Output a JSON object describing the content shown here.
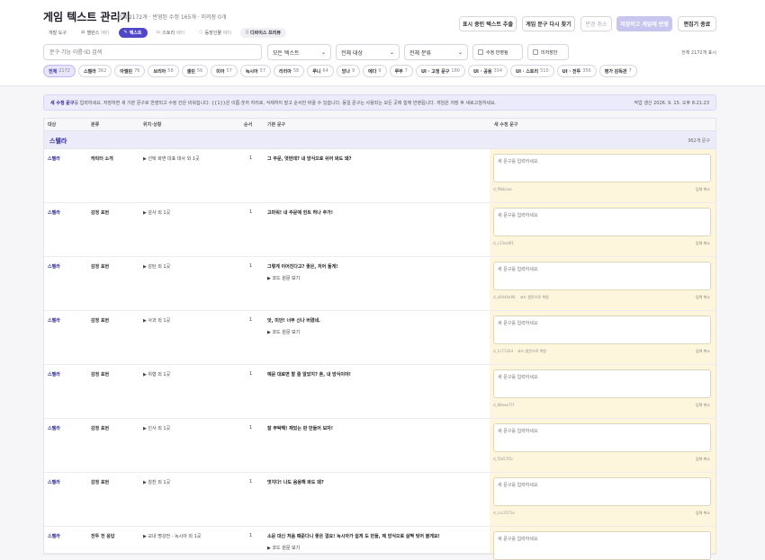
{
  "header": {
    "title": "게임 텍스트 관리기",
    "subtitle": "전체 2172개 · 반영된 수정 165개 · 미저장 0개",
    "buttons": {
      "extract": "표시 중인 텍스트 추출",
      "reload": "게임 문구 다시 찾기",
      "revert": "변경 취소",
      "save": "저장하고 게임에 반영",
      "exit": "편집기 종료"
    },
    "nav": [
      {
        "label": "개발 도구",
        "icon": "",
        "tag": ""
      },
      {
        "label": "밸런스",
        "icon": "⚖",
        "tag": "베타"
      },
      {
        "label": "텍스트",
        "icon": "✎",
        "tag": ""
      },
      {
        "label": "스토리",
        "icon": "▭",
        "tag": "베타"
      },
      {
        "label": "등장인물",
        "icon": "◌",
        "tag": "베타"
      },
      {
        "label": "디바이스 프리뷰",
        "icon": "▯",
        "tag": ""
      }
    ]
  },
  "filters": {
    "search_placeholder": "문구·기능 이름·ID 검색",
    "select1": "모든 텍스트",
    "select2": "전체 대상",
    "select3": "전체 분류",
    "check1": "수정 반영됨",
    "check2": "미저장만",
    "total": "전체 2172개 표시"
  },
  "chips": [
    {
      "label": "전체",
      "count": "2172"
    },
    {
      "label": "스텔라",
      "count": "362"
    },
    {
      "label": "아멜린",
      "count": "76"
    },
    {
      "label": "브리아",
      "count": "58"
    },
    {
      "label": "셀린",
      "count": "56"
    },
    {
      "label": "미아",
      "count": "57"
    },
    {
      "label": "녹시아",
      "count": "57"
    },
    {
      "label": "리리아",
      "count": "58"
    },
    {
      "label": "루니",
      "count": "64"
    },
    {
      "label": "망나",
      "count": "9"
    },
    {
      "label": "에다",
      "count": "9"
    },
    {
      "label": "루무",
      "count": "7"
    },
    {
      "label": "UI · 고정 문구",
      "count": "180"
    },
    {
      "label": "UI · 공용",
      "count": "334"
    },
    {
      "label": "UI · 스토리",
      "count": "510"
    },
    {
      "label": "UI · 전투",
      "count": "356"
    },
    {
      "label": "평가 감독관",
      "count": "7"
    }
  ],
  "notice": {
    "main_bold": "새 수정 문구",
    "main": "를 입력하세요. 저장하면 새 기본 문구로 반영되고 수정 칸은 비워집니다. {{1}}은 이름·숫자 자리로, 삭제하지 말고 순서만 바꿀 수 있습니다. 동일 문구는 사용되는 모든 곳에 함께 반영됩니다. 게임은 저장 후 새로고침하세요.",
    "right": "작업 갱신 2026. 9. 15. 오후 8:21:23"
  },
  "table": {
    "headers": [
      "대상",
      "분류",
      "위치·상황",
      "순서",
      "기본 문구",
      "새 수정 문구"
    ],
    "group": {
      "name": "스텔라",
      "count": "362개 문구"
    },
    "rows": [
      {
        "target": "스텔라",
        "cat": "캐릭터 소개",
        "loc": "▶ 선택 화면 대표 대사 외 1곳",
        "order": "1",
        "text": "그 주문, 엿먼데? 내 방식으로 쉬어 봐도 돼?",
        "toggle": "",
        "placeholder": "새 문구를 입력하세요",
        "code": "d_f9bbcea",
        "note": "",
        "cancel": "입력 취소"
      },
      {
        "target": "스텔라",
        "cat": "감정 표현",
        "loc": "▶ 감사 외 1곳",
        "order": "1",
        "text": "고마워! 내 주문에 힌트 하나 추가!",
        "toggle": "",
        "placeholder": "새 문구를 입력하세요",
        "code": "d_c13ce8f1",
        "note": "",
        "cancel": "입력 취소"
      },
      {
        "target": "스텔라",
        "cat": "감정 표현",
        "loc": "▶ 감탄 외 1곳",
        "order": "1",
        "text": "그렇게 이어진다고? 좋은, 저어 둘게!",
        "toggle": "▶ 코드 원문 보기",
        "placeholder": "새 문구를 입력하세요",
        "code": "d_a0444a96",
        "note": "코드 원문으로 복원",
        "cancel": "입력 취소"
      },
      {
        "target": "스텔라",
        "cat": "감정 표현",
        "loc": "▶ 사과 외 1곳",
        "order": "1",
        "text": "앗, 미안! 너무 신나 버렸네.",
        "toggle": "▶ 코드 원문 보기",
        "placeholder": "새 문구를 입력하세요",
        "code": "d_1c77d2d",
        "note": "코드 원문으로 복원",
        "cancel": "입력 취소"
      },
      {
        "target": "스텔라",
        "cat": "감정 표현",
        "loc": "▶ 위협 외 1곳",
        "order": "1",
        "text": "예문 대로면 할 줄 알았지? 흔, 내 방식이야!",
        "toggle": "",
        "placeholder": "새 문구를 입력하세요",
        "code": "d_88eae7f7",
        "note": "",
        "cancel": "입력 취소"
      },
      {
        "target": "스텔라",
        "cat": "감정 표현",
        "loc": "▶ 인사 외 1곳",
        "order": "1",
        "text": "잘 부탁해! 재밌는 판 만들어 보자!",
        "toggle": "",
        "placeholder": "새 문구를 입력하세요",
        "code": "d_f2b57f2c",
        "note": "",
        "cancel": "입력 취소"
      },
      {
        "target": "스텔라",
        "cat": "감정 표현",
        "loc": "▶ 칭찬 외 1곳",
        "order": "1",
        "text": "멋지다! 나도 음용해 봐도 돼?",
        "toggle": "",
        "placeholder": "새 문구를 입력하세요",
        "code": "d_ccc2571e",
        "note": "",
        "cancel": "입력 취소"
      },
      {
        "target": "스텔라",
        "cat": "전투 전 응답",
        "loc": "▶ 교내 명강전 - 녹시아 외 1곳",
        "order": "1",
        "text": "소문 대신 처음 때준다니 좋은 결요! 녹시아가 쉽게 도 만들, 제 방식으로 살짝 빚어 볼게요!",
        "toggle": "▶ 코드 원문 보기",
        "placeholder": "새 문구를 입력하세요",
        "code": "",
        "note": "",
        "cancel": ""
      }
    ]
  }
}
